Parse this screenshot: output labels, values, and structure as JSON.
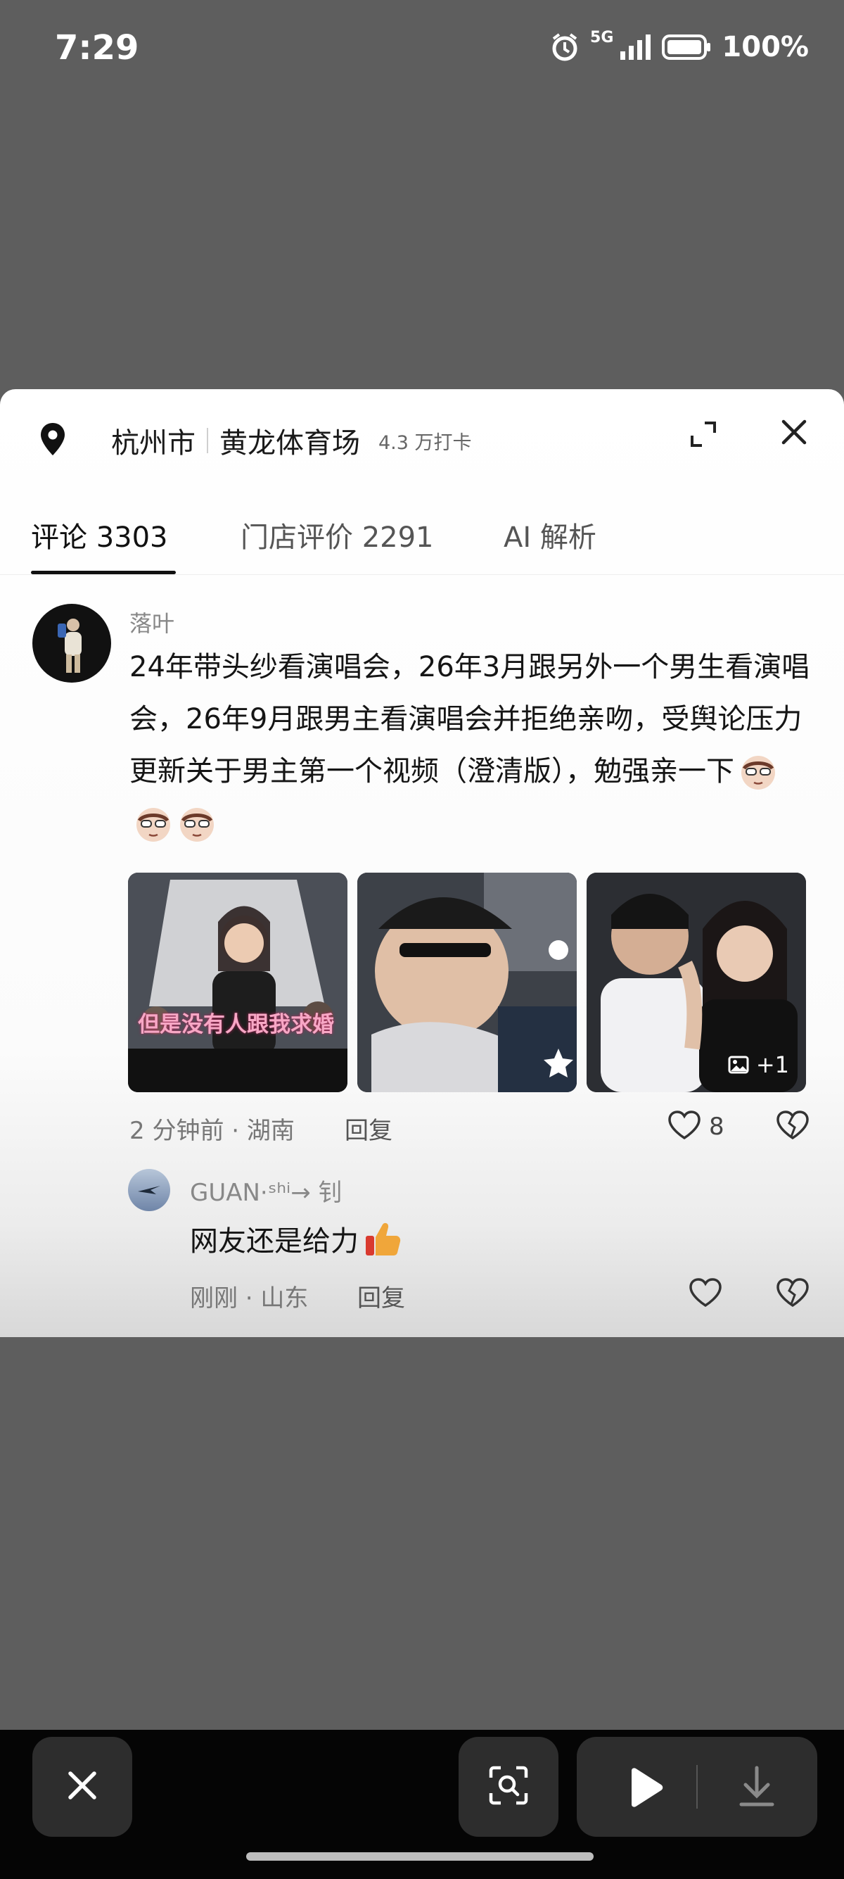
{
  "status_bar": {
    "time": "7:29",
    "network": "5G",
    "battery": "100%"
  },
  "location": {
    "city": "杭州市",
    "venue": "黄龙体育场",
    "checkins": "4.3 万打卡"
  },
  "tabs": [
    {
      "label": "评论 3303",
      "active": true
    },
    {
      "label": "门店评价 2291",
      "active": false
    },
    {
      "label": "AI 解析",
      "active": false
    }
  ],
  "comment": {
    "username": "落叶",
    "text": "24年带头纱看演唱会，26年3月跟另外一个男生看演唱会，26年9月跟男主看演唱会并拒绝亲吻，受舆论压力更新关于男主第一个视频（澄清版），勉强亲一下",
    "images": [
      {
        "caption": "但是没有人跟我求婚"
      },
      {
        "caption": ""
      },
      {
        "more_label": "+1"
      }
    ],
    "time": "2 分钟前 · 湖南",
    "reply_label": "回复",
    "likes": "8"
  },
  "reply": {
    "username": "GUAN·ˢʰⁱ→ 钊",
    "text": "网友还是给力",
    "time": "刚刚 · 山东",
    "reply_label": "回复"
  },
  "colors": {
    "accent_text": "#111111",
    "muted": "#777777",
    "background_dim": "#5e5e5e"
  }
}
